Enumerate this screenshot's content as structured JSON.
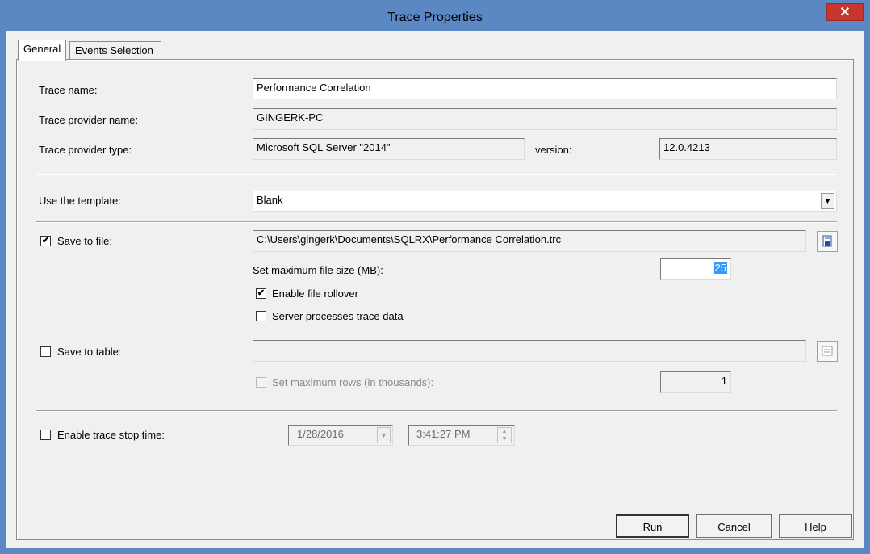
{
  "window": {
    "title": "Trace Properties",
    "close_glyph": "✕"
  },
  "tabs": [
    {
      "label": "General"
    },
    {
      "label": "Events Selection"
    }
  ],
  "general": {
    "trace_name": {
      "label": "Trace name:",
      "value": "Performance Correlation"
    },
    "provider_name": {
      "label": "Trace provider name:",
      "value": "GINGERK-PC"
    },
    "provider_type": {
      "label": "Trace provider type:",
      "value": "Microsoft SQL Server \"2014\""
    },
    "version": {
      "label": "version:",
      "value": "12.0.4213"
    },
    "template": {
      "label": "Use the template:",
      "value": "Blank"
    },
    "save_to_file": {
      "label": "Save to file:",
      "checked": true,
      "value": "C:\\Users\\gingerk\\Documents\\SQLRX\\Performance Correlation.trc"
    },
    "max_file_size": {
      "label": "Set maximum file size (MB):",
      "value": "25"
    },
    "enable_rollover": {
      "label": "Enable file rollover",
      "checked": true
    },
    "server_processes": {
      "label": "Server processes trace data",
      "checked": false
    },
    "save_to_table": {
      "label": "Save to table:",
      "checked": false,
      "value": ""
    },
    "max_rows": {
      "label": "Set maximum rows (in thousands):",
      "checked": false,
      "value": "1"
    },
    "stop_time": {
      "label": "Enable trace stop time:",
      "checked": false,
      "date": "1/28/2016",
      "time": "3:41:27 PM"
    }
  },
  "buttons": {
    "run": "Run",
    "cancel": "Cancel",
    "help": "Help"
  },
  "icons": {
    "check": "✔",
    "dropdown": "▼",
    "spin_up": "▲",
    "spin_down": "▼"
  }
}
